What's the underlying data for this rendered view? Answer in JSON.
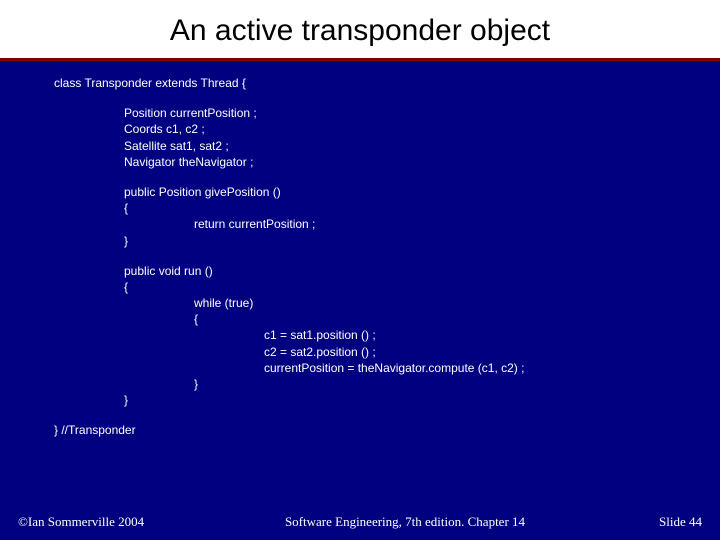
{
  "title": "An active transponder object",
  "code": {
    "classDecl": "class Transponder extends Thread {",
    "fields": [
      "Position currentPosition ;",
      "Coords c1, c2 ;",
      "Satellite sat1, sat2 ;",
      "Navigator theNavigator ;"
    ],
    "method1": {
      "sig": "public Position givePosition ()",
      "open": "{",
      "body": "return currentPosition ;",
      "close": "}"
    },
    "method2": {
      "sig": "public void run ()",
      "open": "{",
      "whileLine": "while (true)",
      "whileOpen": "{",
      "body": [
        "c1 = sat1.position () ;",
        "c2 = sat2.position () ;",
        "currentPosition = theNavigator.compute (c1, c2) ;"
      ],
      "whileClose": "}",
      "close": "}"
    },
    "classClose": "} //Transponder"
  },
  "footer": {
    "left": "©Ian Sommerville 2004",
    "center": "Software Engineering, 7th edition. Chapter 14",
    "right": "Slide 44"
  }
}
